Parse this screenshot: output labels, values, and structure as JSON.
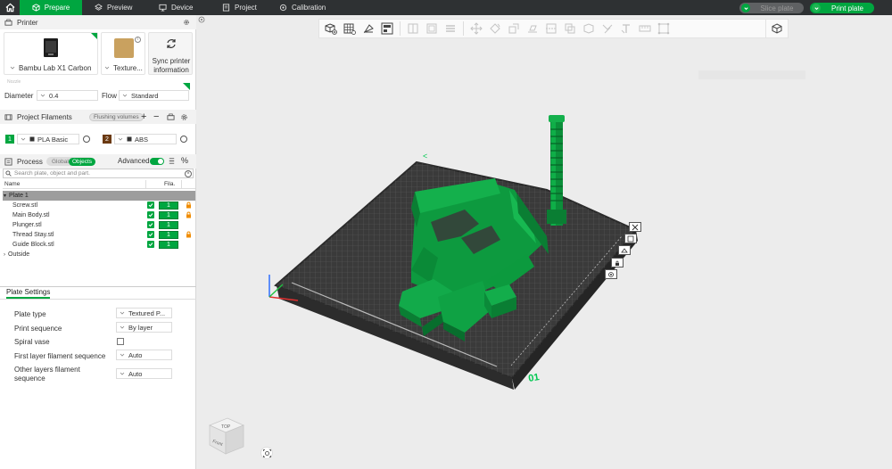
{
  "topbar": {
    "tabs": [
      {
        "label": "Prepare",
        "icon": "cube-icon",
        "active": true
      },
      {
        "label": "Preview",
        "icon": "layers-icon",
        "active": false
      },
      {
        "label": "Device",
        "icon": "monitor-icon",
        "active": false
      },
      {
        "label": "Project",
        "icon": "document-icon",
        "active": false
      },
      {
        "label": "Calibration",
        "icon": "target-icon",
        "active": false
      }
    ],
    "slice_label": "Slice plate",
    "print_label": "Print plate"
  },
  "printer": {
    "section_title": "Printer",
    "printer_name": "Bambu Lab X1 Carbon",
    "plate_name": "Texture...",
    "sync_label_1": "Sync printer",
    "sync_label_2": "information",
    "nozzle_label": "Nozzle",
    "diameter_label": "Diameter",
    "diameter_value": "0.4",
    "flow_label": "Flow",
    "flow_value": "Standard"
  },
  "filaments": {
    "section_title": "Project Filaments",
    "flushing_label": "Flushing volumes",
    "items": [
      {
        "index": "1",
        "name": "PLA Basic",
        "color": "#00a640"
      },
      {
        "index": "2",
        "name": "ABS",
        "color": "#6b3a12"
      }
    ]
  },
  "process": {
    "section_title": "Process",
    "global_label": "Global",
    "objects_label": "Objects",
    "advanced_label": "Advanced",
    "search_placeholder": "Search plate, object and part.",
    "col_name": "Name",
    "col_fila": "Fila.",
    "plate_label": "Plate 1",
    "objects": [
      {
        "name": "Screw.stl",
        "filament": "1",
        "locked": true
      },
      {
        "name": "Main Body.stl",
        "filament": "1",
        "locked": true
      },
      {
        "name": "Plunger.stl",
        "filament": "1",
        "locked": false
      },
      {
        "name": "Thread Stay.stl",
        "filament": "1",
        "locked": true
      },
      {
        "name": "Guide Block.stl",
        "filament": "1",
        "locked": false
      }
    ],
    "outside_label": "Outside"
  },
  "plate_settings": {
    "tab_label": "Plate Settings",
    "plate_type_label": "Plate type",
    "plate_type_value": "Textured P...",
    "print_sequence_label": "Print sequence",
    "print_sequence_value": "By layer",
    "spiral_vase_label": "Spiral vase",
    "first_layer_label": "First layer filament sequence",
    "first_layer_value": "Auto",
    "other_layers_label_1": "Other layers filament",
    "other_layers_label_2": "sequence",
    "other_layers_value": "Auto"
  },
  "viewport": {
    "plate_number": "01",
    "view_cube_top": "TOP",
    "view_cube_front": "Front"
  },
  "colors": {
    "accent": "#00a640",
    "topbar": "#2e3133",
    "model": "#00a640",
    "bed": "#3a3a3a"
  }
}
